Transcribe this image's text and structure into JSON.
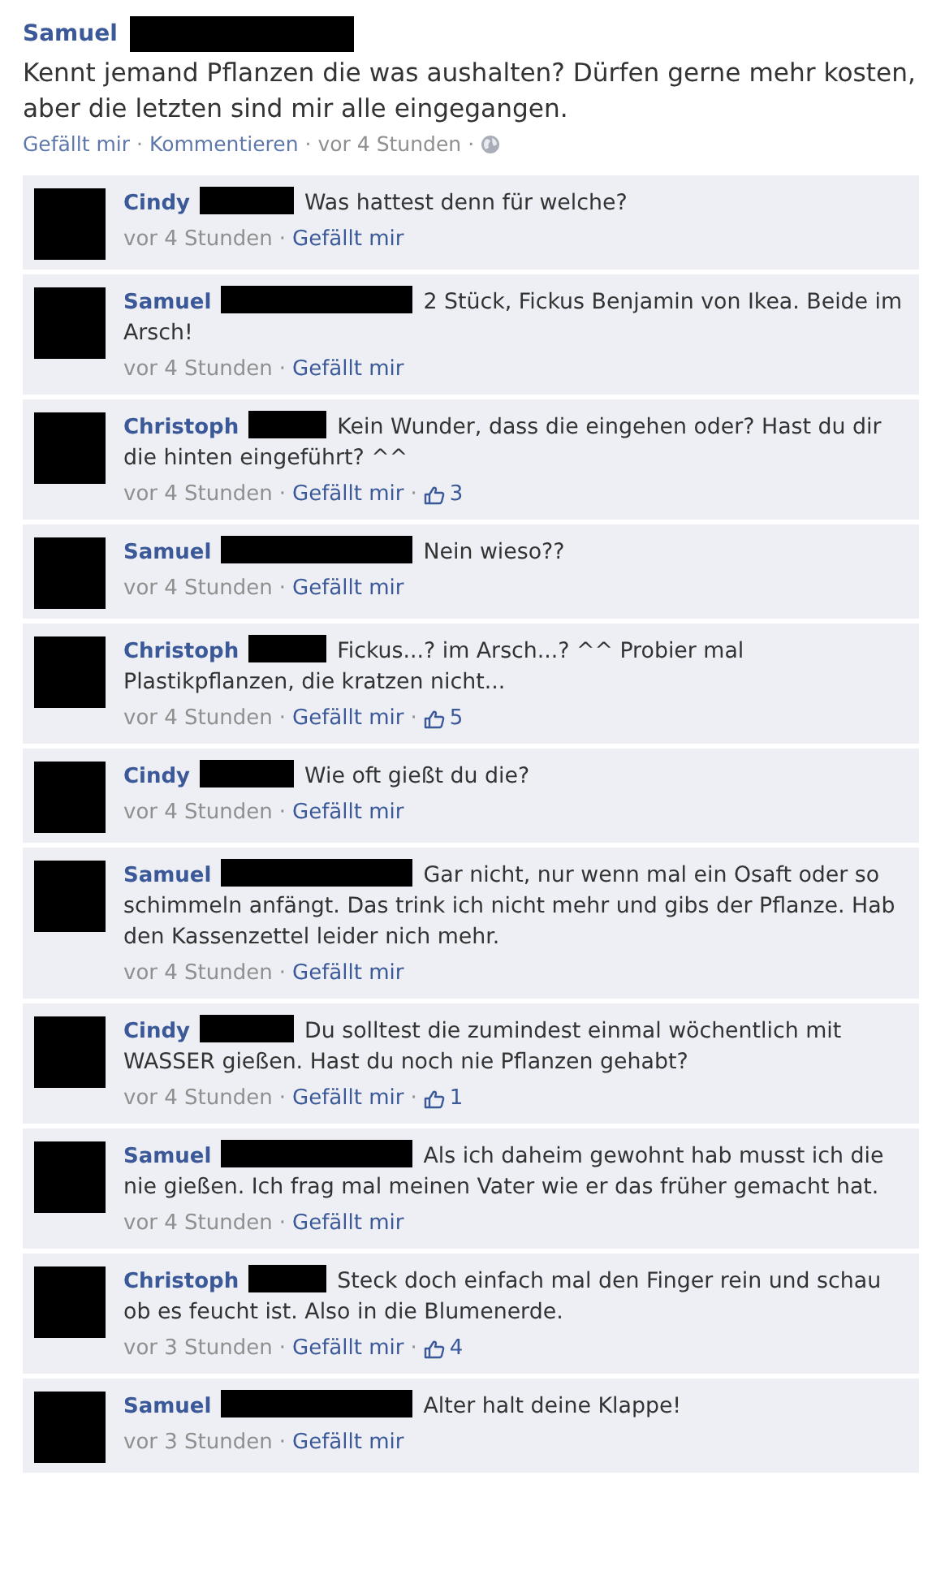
{
  "separator": "·",
  "post": {
    "author": "Samuel",
    "text": "Kennt jemand Pflanzen die was aushalten? Dürfen gerne mehr kosten, aber die letzten sind mir alle eingegangen.",
    "like_action": "Gefällt mir",
    "comment_action": "Kommentieren",
    "time": "vor 4 Stunden"
  },
  "comments": [
    {
      "author": "Cindy",
      "text": "Was hattest denn für welche?",
      "time": "vor 4 Stunden",
      "like_action": "Gefällt mir"
    },
    {
      "author": "Samuel",
      "text": "2 Stück, Fickus Benjamin von Ikea. Beide im Arsch!",
      "time": "vor 4 Stunden",
      "like_action": "Gefällt mir"
    },
    {
      "author": "Christoph",
      "text": "Kein Wunder, dass die eingehen oder? Hast du dir die hinten eingeführt? ^^",
      "time": "vor 4 Stunden",
      "like_action": "Gefällt mir",
      "likes": "3"
    },
    {
      "author": "Samuel",
      "text": "Nein wieso??",
      "time": "vor 4 Stunden",
      "like_action": "Gefällt mir"
    },
    {
      "author": "Christoph",
      "text": "Fickus...? im Arsch...? ^^ Probier mal Plastikpflanzen, die kratzen nicht...",
      "time": "vor 4 Stunden",
      "like_action": "Gefällt mir",
      "likes": "5"
    },
    {
      "author": "Cindy",
      "text": "Wie oft gießt du die?",
      "time": "vor 4 Stunden",
      "like_action": "Gefällt mir"
    },
    {
      "author": "Samuel",
      "text": "Gar nicht, nur wenn mal ein Osaft oder so schimmeln anfängt. Das trink ich nicht mehr und gibs der Pflanze. Hab den Kassenzettel leider nich mehr.",
      "time": "vor 4 Stunden",
      "like_action": "Gefällt mir"
    },
    {
      "author": "Cindy",
      "text": "Du solltest die zumindest einmal wöchentlich mit WASSER gießen. Hast du noch nie Pflanzen gehabt?",
      "time": "vor 4 Stunden",
      "like_action": "Gefällt mir",
      "likes": "1"
    },
    {
      "author": "Samuel",
      "text": "Als ich daheim gewohnt hab musst ich die nie gießen. Ich frag mal meinen Vater wie er das früher gemacht hat.",
      "time": "vor 4 Stunden",
      "like_action": "Gefällt mir"
    },
    {
      "author": "Christoph",
      "text": "Steck doch einfach mal den Finger rein und schau ob es feucht ist. Also in die Blumenerde.",
      "time": "vor 3 Stunden",
      "like_action": "Gefällt mir",
      "likes": "4"
    },
    {
      "author": "Samuel",
      "text": "Alter halt deine Klappe!",
      "time": "vor 3 Stunden",
      "like_action": "Gefällt mir"
    }
  ]
}
